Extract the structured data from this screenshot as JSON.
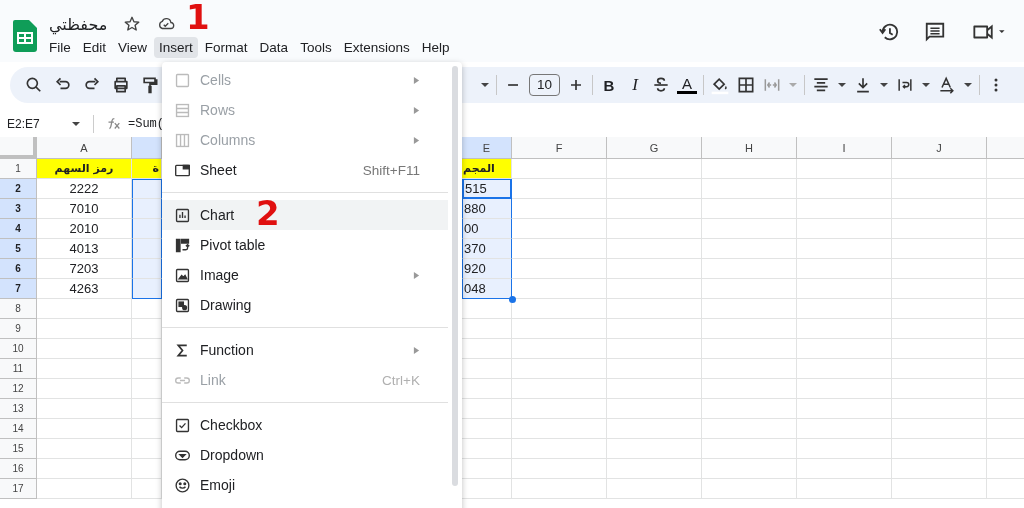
{
  "document": {
    "title": "محفظتي"
  },
  "menu_bar": [
    {
      "label": "File",
      "selected": false
    },
    {
      "label": "Edit",
      "selected": false
    },
    {
      "label": "View",
      "selected": false
    },
    {
      "label": "Insert",
      "selected": true
    },
    {
      "label": "Format",
      "selected": false
    },
    {
      "label": "Data",
      "selected": false
    },
    {
      "label": "Tools",
      "selected": false
    },
    {
      "label": "Extensions",
      "selected": false
    },
    {
      "label": "Help",
      "selected": false
    }
  ],
  "toolbar": {
    "font_size": "10",
    "bold": "B",
    "italic": "I",
    "text_color": "A"
  },
  "formula_bar": {
    "name_box": "E2:E7",
    "formula": "=Sum("
  },
  "sheet": {
    "columns": [
      {
        "label": "A",
        "selected": false
      },
      {
        "selected": true
      },
      {
        "label": "E",
        "selected": true
      },
      {
        "label": "F",
        "selected": false
      },
      {
        "label": "G",
        "selected": false
      },
      {
        "label": "H",
        "selected": false
      },
      {
        "label": "I",
        "selected": false
      },
      {
        "label": "J",
        "selected": false
      },
      {
        "selected": false
      }
    ],
    "rows": [
      {
        "number": "1",
        "selected": false,
        "kind": "header",
        "a": "رمز السهم",
        "b": "ة",
        "e": "المجم"
      },
      {
        "number": "2",
        "selected": true,
        "a": "2222",
        "e": "515"
      },
      {
        "number": "3",
        "selected": true,
        "a": "7010",
        "e": "880"
      },
      {
        "number": "4",
        "selected": true,
        "a": "2010",
        "e": "00"
      },
      {
        "number": "5",
        "selected": true,
        "a": "4013",
        "e": "370"
      },
      {
        "number": "6",
        "selected": true,
        "a": "7203",
        "e": "920"
      },
      {
        "number": "7",
        "selected": true,
        "a": "4263",
        "e": "048"
      },
      {
        "number": "8",
        "selected": false
      },
      {
        "number": "9",
        "selected": false
      },
      {
        "number": "10",
        "selected": false
      },
      {
        "number": "11",
        "selected": false
      },
      {
        "number": "12",
        "selected": false
      },
      {
        "number": "13",
        "selected": false
      },
      {
        "number": "14",
        "selected": false
      },
      {
        "number": "15",
        "selected": false
      },
      {
        "number": "16",
        "selected": false
      },
      {
        "number": "17",
        "selected": false
      }
    ]
  },
  "insert_menu": [
    {
      "kind": "item",
      "label": "Cells",
      "disabled": true,
      "submenu": true,
      "selected": false
    },
    {
      "kind": "item",
      "label": "Rows",
      "disabled": true,
      "submenu": true,
      "selected": false
    },
    {
      "kind": "item",
      "label": "Columns",
      "disabled": true,
      "submenu": true,
      "selected": false
    },
    {
      "kind": "item",
      "label": "Sheet",
      "shortcut": "Shift+F11",
      "disabled": false,
      "submenu": false,
      "selected": false
    },
    {
      "kind": "divider"
    },
    {
      "kind": "item",
      "label": "Chart",
      "disabled": false,
      "submenu": false,
      "selected": true
    },
    {
      "kind": "item",
      "label": "Pivot table",
      "disabled": false,
      "submenu": false,
      "selected": false
    },
    {
      "kind": "item",
      "label": "Image",
      "disabled": false,
      "submenu": true,
      "selected": false
    },
    {
      "kind": "item",
      "label": "Drawing",
      "disabled": false,
      "submenu": false,
      "selected": false
    },
    {
      "kind": "divider"
    },
    {
      "kind": "item",
      "label": "Function",
      "disabled": false,
      "submenu": true,
      "selected": false
    },
    {
      "kind": "item",
      "label": "Link",
      "shortcut": "Ctrl+K",
      "disabled": true,
      "submenu": false,
      "selected": false
    },
    {
      "kind": "divider"
    },
    {
      "kind": "item",
      "label": "Checkbox",
      "disabled": false,
      "submenu": false,
      "selected": false
    },
    {
      "kind": "item",
      "label": "Dropdown",
      "disabled": false,
      "submenu": false,
      "selected": false
    },
    {
      "kind": "item",
      "label": "Emoji",
      "disabled": false,
      "submenu": false,
      "selected": false
    }
  ],
  "annotations": [
    {
      "text": "1"
    },
    {
      "text": "2"
    }
  ]
}
